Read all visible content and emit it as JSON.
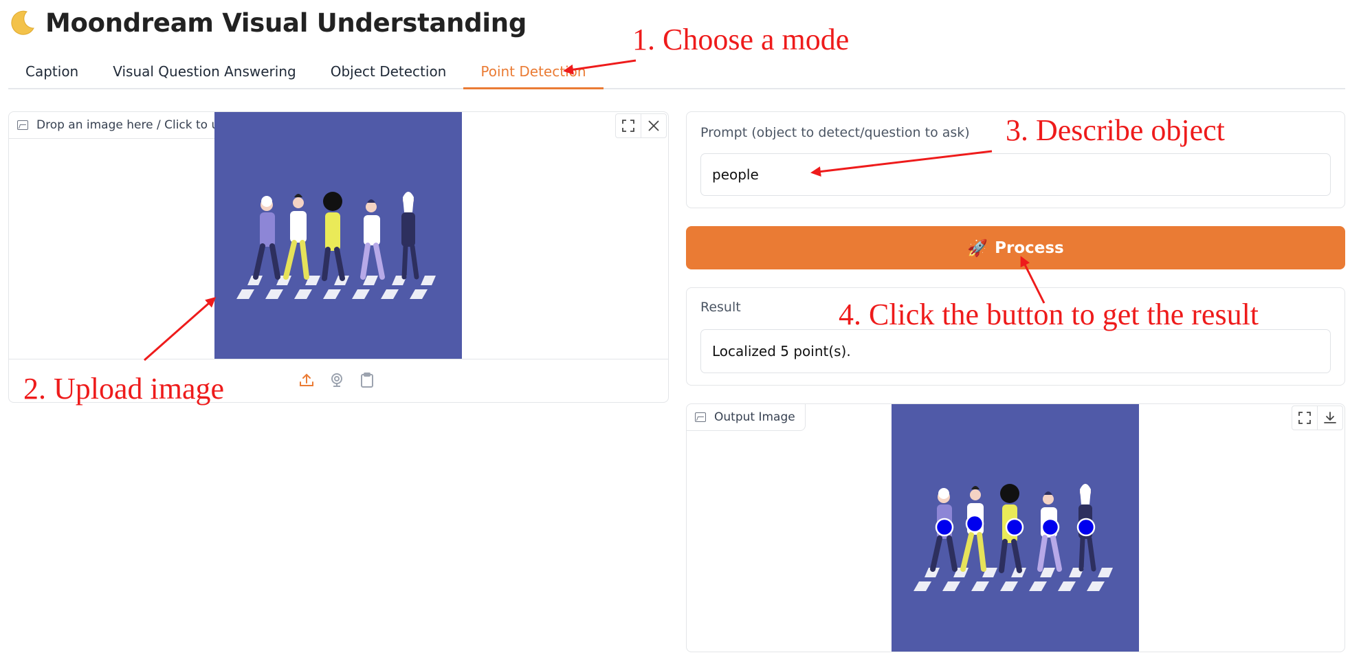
{
  "header": {
    "title": "Moondream Visual Understanding",
    "icon": "crescent-moon-icon"
  },
  "tabs": [
    {
      "label": "Caption",
      "active": false
    },
    {
      "label": "Visual Question Answering",
      "active": false
    },
    {
      "label": "Object Detection",
      "active": false
    },
    {
      "label": "Point Detection",
      "active": true
    }
  ],
  "upload": {
    "label": "Drop an image here / Click to upload",
    "icons": [
      "image-icon",
      "fullscreen-icon",
      "close-icon",
      "upload-icon",
      "webcam-icon",
      "clipboard-icon"
    ]
  },
  "prompt": {
    "label": "Prompt (object to detect/question to ask)",
    "value": "people"
  },
  "process_button": {
    "label": "Process",
    "icon": "rocket-icon"
  },
  "result": {
    "label": "Result",
    "value": "Localized 5 point(s)."
  },
  "output": {
    "label": "Output Image",
    "icons": [
      "image-icon",
      "fullscreen-icon",
      "download-icon"
    ],
    "point_count": 5
  },
  "annotations": {
    "step1": "1. Choose a mode",
    "step2": "2. Upload image",
    "step3": "3. Describe object",
    "step4": "4. Click the button to get the result"
  },
  "colors": {
    "accent": "#ea7b34",
    "annotation": "#ee1b1b",
    "image_background": "#505aa8",
    "detected_point": "#0000ee"
  }
}
